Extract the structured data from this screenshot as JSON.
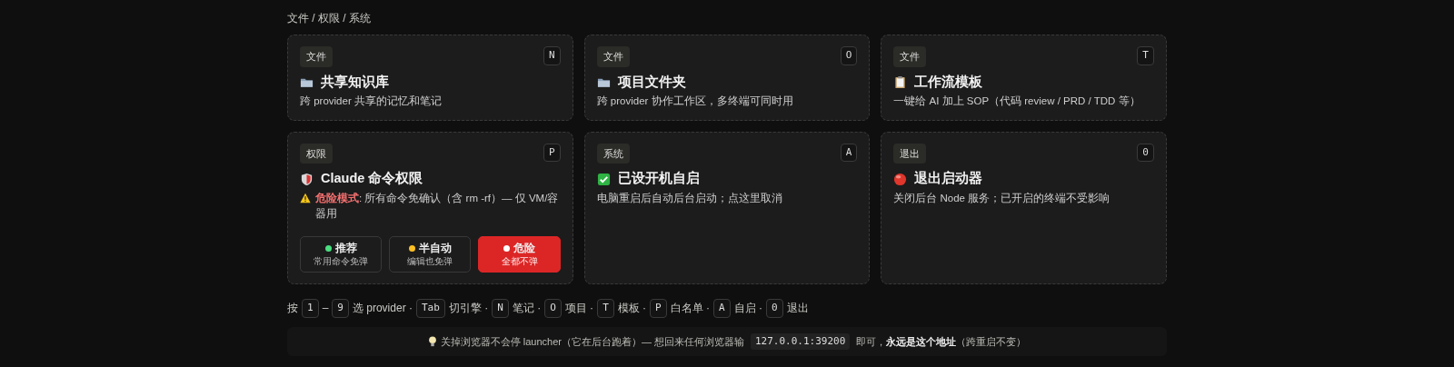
{
  "breadcrumb": "文件 / 权限 / 系统",
  "cards": [
    {
      "tag": "文件",
      "key": "N",
      "kind": "folder",
      "title": "共享知识库",
      "desc": "跨 provider 共享的记忆和笔记"
    },
    {
      "tag": "文件",
      "key": "O",
      "kind": "folder",
      "title": "项目文件夹",
      "desc": "跨 provider 协作工作区，多终端可同时用"
    },
    {
      "tag": "文件",
      "key": "T",
      "kind": "clipboard",
      "title": "工作流模板",
      "desc": "一键给 AI 加上 SOP（代码 review / PRD / TDD 等）"
    },
    {
      "tag": "权限",
      "key": "P",
      "kind": "shield",
      "title": "Claude 命令权限",
      "warning": true,
      "desc": "**危险模式**: 所有命令免确认（含 rm -rf）— 仅 VM/容器用",
      "modes": [
        {
          "label": "推荐",
          "sub": "常用命令免弹",
          "color": "#4ade80",
          "selected": false
        },
        {
          "label": "半自动",
          "sub": "编辑也免弹",
          "color": "#fbbf24",
          "selected": false
        },
        {
          "label": "危险",
          "sub": "全都不弹",
          "color": "#ffffff",
          "selected": true
        }
      ]
    },
    {
      "tag": "系统",
      "key": "A",
      "kind": "check",
      "title": "已设开机自启",
      "desc": "电脑重启后自动后台启动；点这里取消"
    },
    {
      "tag": "退出",
      "key": "0",
      "kind": "stop",
      "title": "退出启动器",
      "desc": "关闭后台 Node 服务；已开启的终端不受影响"
    }
  ],
  "hints": [
    {
      "kind": "text",
      "text": "按"
    },
    {
      "kind": "key",
      "text": "1"
    },
    {
      "kind": "text",
      "text": "–"
    },
    {
      "kind": "key",
      "text": "9"
    },
    {
      "kind": "text",
      "text": "选 provider ·"
    },
    {
      "kind": "key",
      "text": "Tab"
    },
    {
      "kind": "text",
      "text": "切引擎 ·"
    },
    {
      "kind": "key",
      "text": "N"
    },
    {
      "kind": "text",
      "text": "笔记 ·"
    },
    {
      "kind": "key",
      "text": "O"
    },
    {
      "kind": "text",
      "text": "项目 ·"
    },
    {
      "kind": "key",
      "text": "T"
    },
    {
      "kind": "text",
      "text": "模板 ·"
    },
    {
      "kind": "key",
      "text": "P"
    },
    {
      "kind": "text",
      "text": "白名单 ·"
    },
    {
      "kind": "key",
      "text": "A"
    },
    {
      "kind": "text",
      "text": "自启 ·"
    },
    {
      "kind": "key",
      "text": "0"
    },
    {
      "kind": "text",
      "text": "退出"
    }
  ],
  "notice": [
    {
      "kind": "text",
      "text": "关掉浏览器不会停 launcher（它在后台跑着）— 想回来任何浏览器输"
    },
    {
      "kind": "code",
      "text": "127.0.0.1:39200"
    },
    {
      "kind": "text",
      "text": "即可，**永远是这个地址**（跨重启不变）"
    }
  ]
}
